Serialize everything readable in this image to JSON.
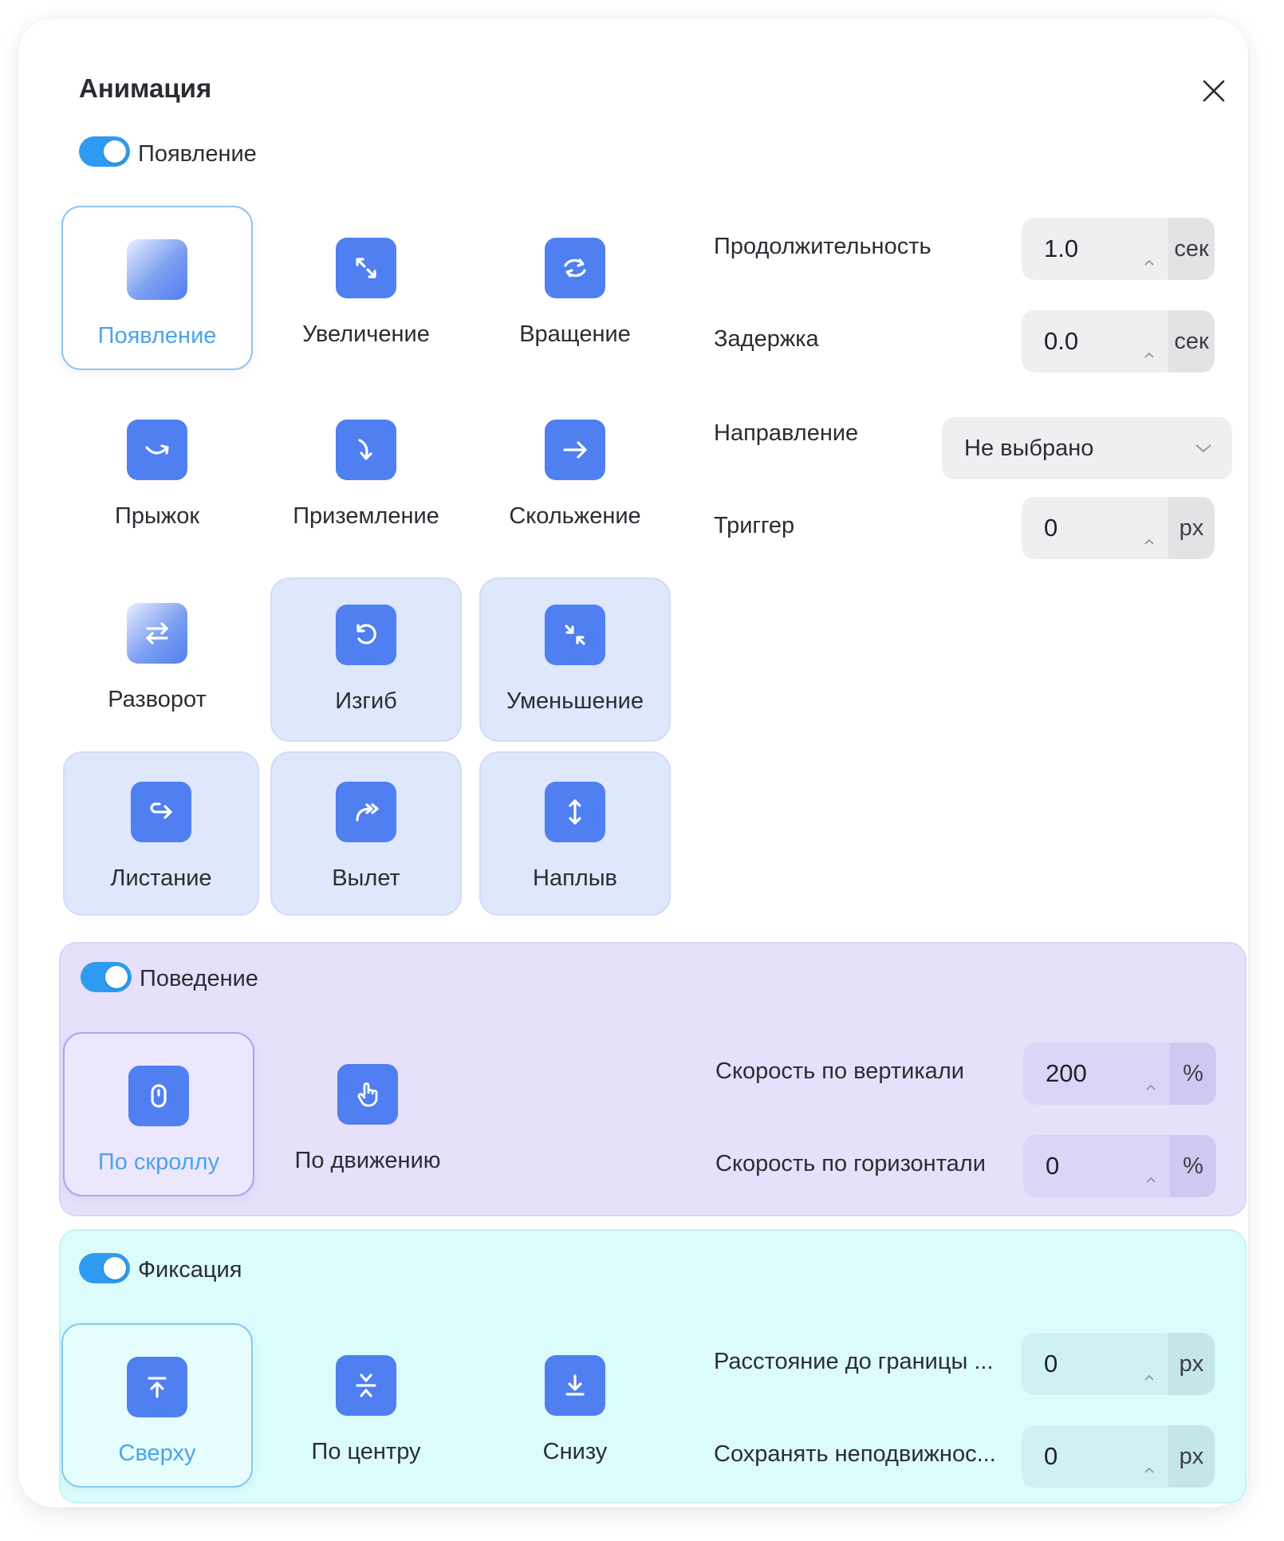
{
  "dialog": {
    "title": "Анимация"
  },
  "appear": {
    "label": "Появление",
    "enabled": true,
    "tiles": [
      {
        "label": "Появление",
        "icon": "fade-icon",
        "state": "selected"
      },
      {
        "label": "Увеличение",
        "icon": "expand-icon",
        "state": "normal"
      },
      {
        "label": "Вращение",
        "icon": "rotate-icon",
        "state": "normal"
      },
      {
        "label": "Прыжок",
        "icon": "jump-icon",
        "state": "normal"
      },
      {
        "label": "Приземление",
        "icon": "landing-icon",
        "state": "normal"
      },
      {
        "label": "Скольжение",
        "icon": "slide-icon",
        "state": "normal"
      },
      {
        "label": "Разворот",
        "icon": "flip-icon",
        "state": "normal"
      },
      {
        "label": "Изгиб",
        "icon": "bend-icon",
        "state": "highlighted"
      },
      {
        "label": "Уменьшение",
        "icon": "shrink-icon",
        "state": "highlighted"
      },
      {
        "label": "Листание",
        "icon": "page-turn-icon",
        "state": "highlighted"
      },
      {
        "label": "Вылет",
        "icon": "fly-out-icon",
        "state": "highlighted"
      },
      {
        "label": "Наплыв",
        "icon": "float-icon",
        "state": "highlighted"
      }
    ],
    "fields": {
      "duration": {
        "label": "Продолжительность",
        "value": "1.0",
        "unit": "сек"
      },
      "delay": {
        "label": "Задержка",
        "value": "0.0",
        "unit": "сек"
      },
      "direction": {
        "label": "Направление",
        "value": "Не выбрано"
      },
      "trigger": {
        "label": "Триггер",
        "value": "0",
        "unit": "px"
      }
    }
  },
  "behavior": {
    "label": "Поведение",
    "enabled": true,
    "tiles": [
      {
        "label": "По скроллу",
        "icon": "mouse-icon",
        "state": "selected"
      },
      {
        "label": "По движению",
        "icon": "pointer-hand-icon",
        "state": "normal"
      }
    ],
    "fields": {
      "vertical_speed": {
        "label": "Скорость по вертикали",
        "value": "200",
        "unit": "%"
      },
      "horizontal_speed": {
        "label": "Скорость по горизонтали",
        "value": "0",
        "unit": "%"
      }
    }
  },
  "fixation": {
    "label": "Фиксация",
    "enabled": true,
    "tiles": [
      {
        "label": "Сверху",
        "icon": "align-top-icon",
        "state": "selected"
      },
      {
        "label": "По центру",
        "icon": "align-center-icon",
        "state": "normal"
      },
      {
        "label": "Снизу",
        "icon": "align-bottom-icon",
        "state": "normal"
      }
    ],
    "fields": {
      "border_distance": {
        "label": "Расстояние до границы ...",
        "value": "0",
        "unit": "px"
      },
      "keep_fixed": {
        "label": "Сохранять неподвижнос...",
        "value": "0",
        "unit": "px"
      }
    }
  },
  "colors": {
    "accent": "#2e9bf0",
    "icon_bg": "#4f7ff0",
    "selected_text": "#4aa3ef",
    "behavior_panel": "#e6e0fb",
    "fixation_panel": "#dcfcfc"
  }
}
